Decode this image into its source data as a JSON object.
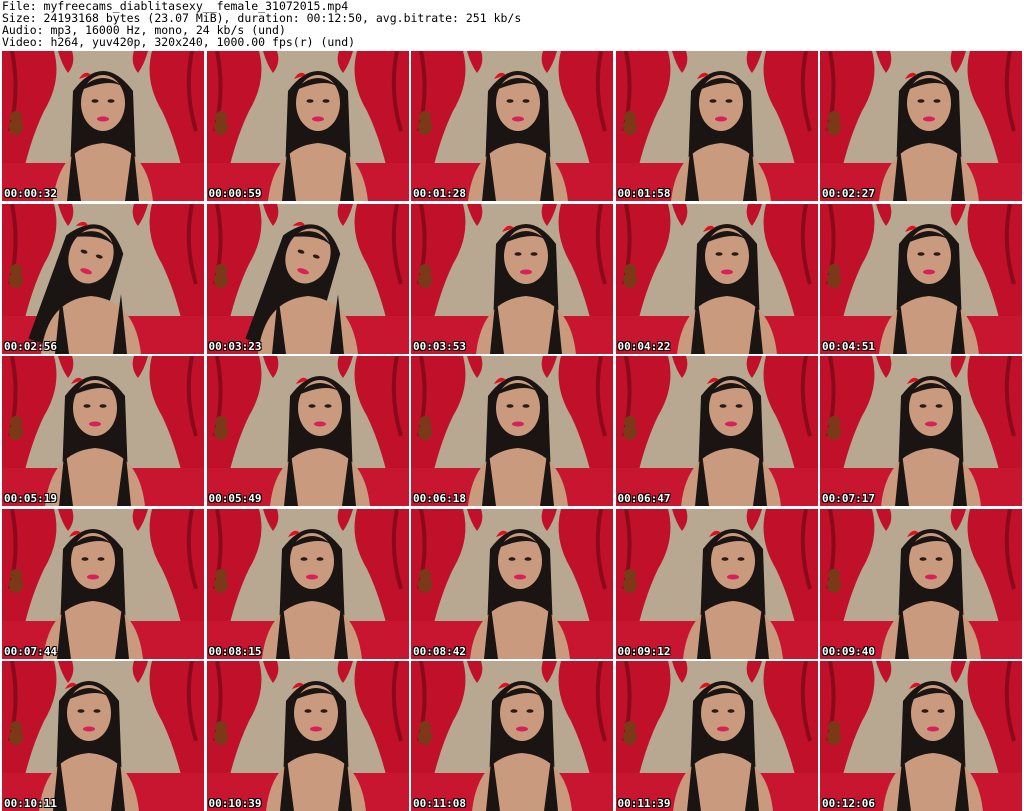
{
  "header": {
    "file": "File: myfreecams_diablitasexy__female_31072015.mp4",
    "size": "Size: 24193168 bytes (23.07 MiB), duration: 00:12:50, avg.bitrate: 251 kb/s",
    "audio": "Audio: mp3, 16000 Hz, mono, 24 kb/s (und)",
    "video": "Video: h264, yuv420p, 320x240, 1000.00 fps(r) (und)"
  },
  "thumbnails": [
    {
      "timestamp": "00:00:32"
    },
    {
      "timestamp": "00:00:59"
    },
    {
      "timestamp": "00:01:28"
    },
    {
      "timestamp": "00:01:58"
    },
    {
      "timestamp": "00:02:27"
    },
    {
      "timestamp": "00:02:56"
    },
    {
      "timestamp": "00:03:23"
    },
    {
      "timestamp": "00:03:53"
    },
    {
      "timestamp": "00:04:22"
    },
    {
      "timestamp": "00:04:51"
    },
    {
      "timestamp": "00:05:19"
    },
    {
      "timestamp": "00:05:49"
    },
    {
      "timestamp": "00:06:18"
    },
    {
      "timestamp": "00:06:47"
    },
    {
      "timestamp": "00:07:17"
    },
    {
      "timestamp": "00:07:44"
    },
    {
      "timestamp": "00:08:15"
    },
    {
      "timestamp": "00:08:42"
    },
    {
      "timestamp": "00:09:12"
    },
    {
      "timestamp": "00:09:40"
    },
    {
      "timestamp": "00:10:11"
    },
    {
      "timestamp": "00:10:39"
    },
    {
      "timestamp": "00:11:08"
    },
    {
      "timestamp": "00:11:39"
    },
    {
      "timestamp": "00:12:06"
    }
  ],
  "colors": {
    "curtain": "#c0102a",
    "curtain_dark": "#8a0a1c",
    "wall": "#b9a891",
    "bed": "#c81530",
    "skin": "#c99a7e",
    "hair": "#1a1412",
    "timestamp_text": "#ffffff"
  }
}
